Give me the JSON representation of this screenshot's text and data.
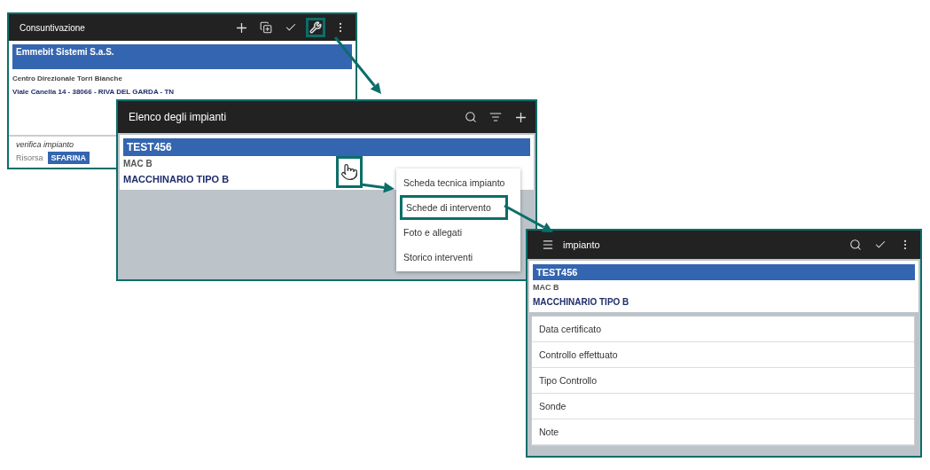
{
  "screens": [
    {
      "kind": "customer",
      "title": "Consuntivazione",
      "toolbar": [
        {
          "kind": "plus",
          "highlighted": false
        },
        {
          "kind": "copy",
          "highlighted": false
        },
        {
          "kind": "check",
          "highlighted": false
        },
        {
          "kind": "wrench",
          "highlighted": true
        },
        {
          "kind": "more",
          "highlighted": false
        }
      ],
      "customer": {
        "name": "Emmebit Sistemi S.a.S.",
        "address_line_1": "Centro Direzionale Torri Bianche",
        "address_line_2": "Viale Canella 14 - 38066 - RIVA DEL GARDA - TN"
      },
      "activity": "verifica impianto",
      "resource_label": "Risorsa",
      "resource": "SFARINA"
    },
    {
      "kind": "list",
      "title": "Elenco degli impianti",
      "toolbar": [
        {
          "kind": "search",
          "highlighted": false
        },
        {
          "kind": "sort",
          "highlighted": false
        },
        {
          "kind": "plus",
          "highlighted": false
        }
      ],
      "item": {
        "code": "TEST456",
        "model": "MAC B",
        "type": "MACCHINARIO TIPO B",
        "selected": true
      },
      "context_menu": [
        {
          "label": "Scheda tecnica impianto",
          "highlighted": false
        },
        {
          "label": "Schede di intervento",
          "highlighted": true
        },
        {
          "label": "Foto e allegati",
          "highlighted": false
        },
        {
          "label": "Storico interventi",
          "highlighted": false
        }
      ]
    },
    {
      "kind": "form",
      "title": "impianto",
      "toolbar": [
        {
          "kind": "search",
          "highlighted": false
        },
        {
          "kind": "check",
          "highlighted": false
        },
        {
          "kind": "more",
          "highlighted": false
        }
      ],
      "item": {
        "code": "TEST456",
        "model": "MAC B",
        "type": "MACCHINARIO TIPO B",
        "selected": true
      },
      "fields": [
        {
          "label": "Data certificato"
        },
        {
          "label": "Controllo effettuato"
        },
        {
          "label": "Tipo Controllo"
        },
        {
          "label": "Sonde"
        },
        {
          "label": "Note"
        }
      ]
    }
  ]
}
